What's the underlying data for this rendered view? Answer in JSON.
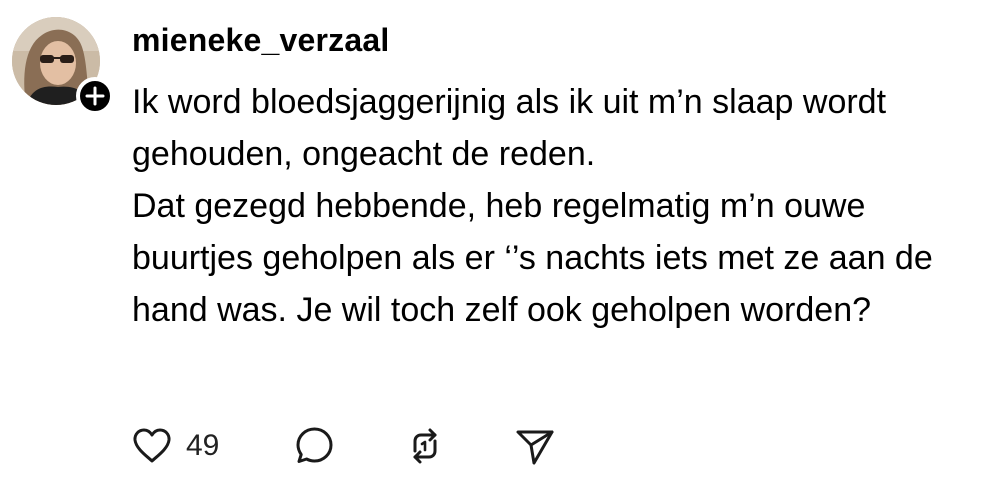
{
  "post": {
    "username": "mieneke_verzaal",
    "avatar_icon": "user-profile-photo",
    "follow_icon": "plus-icon",
    "body_paragraphs": [
      "Ik word bloedsjaggerijnig als ik uit m’n slaap wordt gehouden, ongeacht de reden.",
      "Dat gezegd hebbende, heb regelmatig m’n ouwe buurtjes geholpen als er ‘’s nachts iets met ze aan de hand was. Je wil toch zelf ook geholpen worden?"
    ]
  },
  "actions": {
    "like_icon": "heart-icon",
    "like_count": "49",
    "comment_icon": "comment-bubble-icon",
    "repost_icon": "repost-icon",
    "share_icon": "send-icon"
  },
  "colors": {
    "text": "#000000",
    "icon": "#1a1a1a",
    "background": "#ffffff"
  }
}
